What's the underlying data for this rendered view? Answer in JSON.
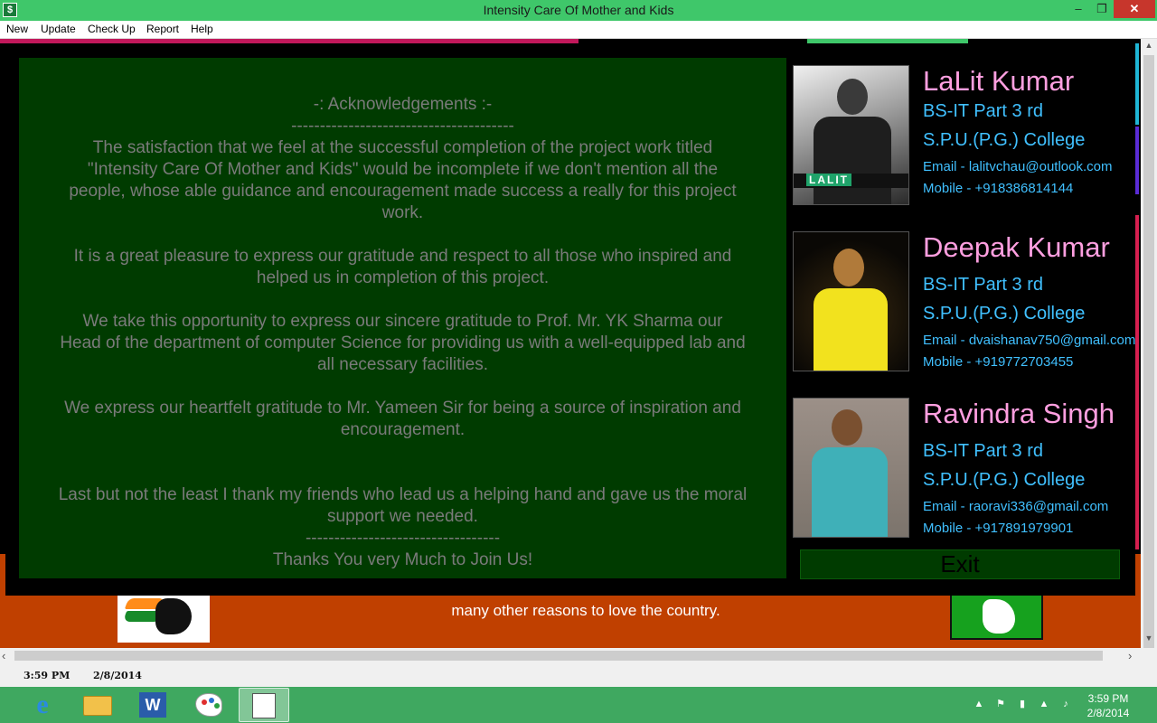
{
  "window": {
    "title": "Intensity Care Of Mother and Kids",
    "minimize_glyph": "–",
    "maximize_glyph": "❐",
    "close_glyph": "✕"
  },
  "menu": [
    "New",
    "Update",
    "Check Up",
    "Report",
    "Help"
  ],
  "acknowledgement": {
    "lines": [
      "-: Acknowledgements :-",
      "---------------------------------------",
      "The satisfaction that we feel at the successful completion of the project work titled",
      "\"Intensity Care Of Mother and Kids\" would be incomplete if we don't mention all the",
      "people, whose able guidance and encouragement made success a really for this project",
      "work.",
      "It is a great pleasure to express our gratitude and respect to all those who inspired and",
      "helped us in completion of this project.",
      "We take this opportunity to express our sincere gratitude to Prof. Mr. YK Sharma our",
      "Head of the department of computer Science for providing us with a well-equipped lab and",
      "all necessary facilities.",
      "We express our heartfelt gratitude to Mr. Yameen Sir for being a source of inspiration and",
      "encouragement.",
      "Last but not the least I thank my friends who lead us a helping hand and gave us the moral",
      "support we needed.",
      "----------------------------------",
      "Thanks You very Much to Join Us!"
    ]
  },
  "team": [
    {
      "name": "LaLit Kumar",
      "course": "BS-IT Part 3 rd",
      "college": "S.P.U.(P.G.) College",
      "email": "Email - lalitvchau@outlook.com",
      "mobile": "Mobile - +918386814144",
      "photo_caption": "LALIT"
    },
    {
      "name": "Deepak Kumar",
      "course": "BS-IT Part 3 rd",
      "college": "S.P.U.(P.G.) College",
      "email": "Email - dvaishanav750@gmail.com",
      "mobile": "Mobile - +919772703455"
    },
    {
      "name": "Ravindra Singh",
      "course": "BS-IT Part 3 rd",
      "college": "S.P.U.(P.G.) College",
      "email": "Email - raoravi336@gmail.com",
      "mobile": "Mobile - +917891979901"
    }
  ],
  "exit_label": "Exit",
  "background": {
    "banner_text": "many other reasons to love the country."
  },
  "statusbar": {
    "time": "3:59 PM",
    "date": "2/8/2014"
  },
  "taskbar": {
    "ie_glyph": "e",
    "word_glyph": "W",
    "tray_time": "3:59 PM",
    "tray_date": "2/8/2014"
  },
  "colors": {
    "titlebar": "#3fc76a",
    "panel": "#003b00",
    "name": "#ff9fe0",
    "info": "#40c0ff",
    "ack_text": "#7a7a7a"
  }
}
